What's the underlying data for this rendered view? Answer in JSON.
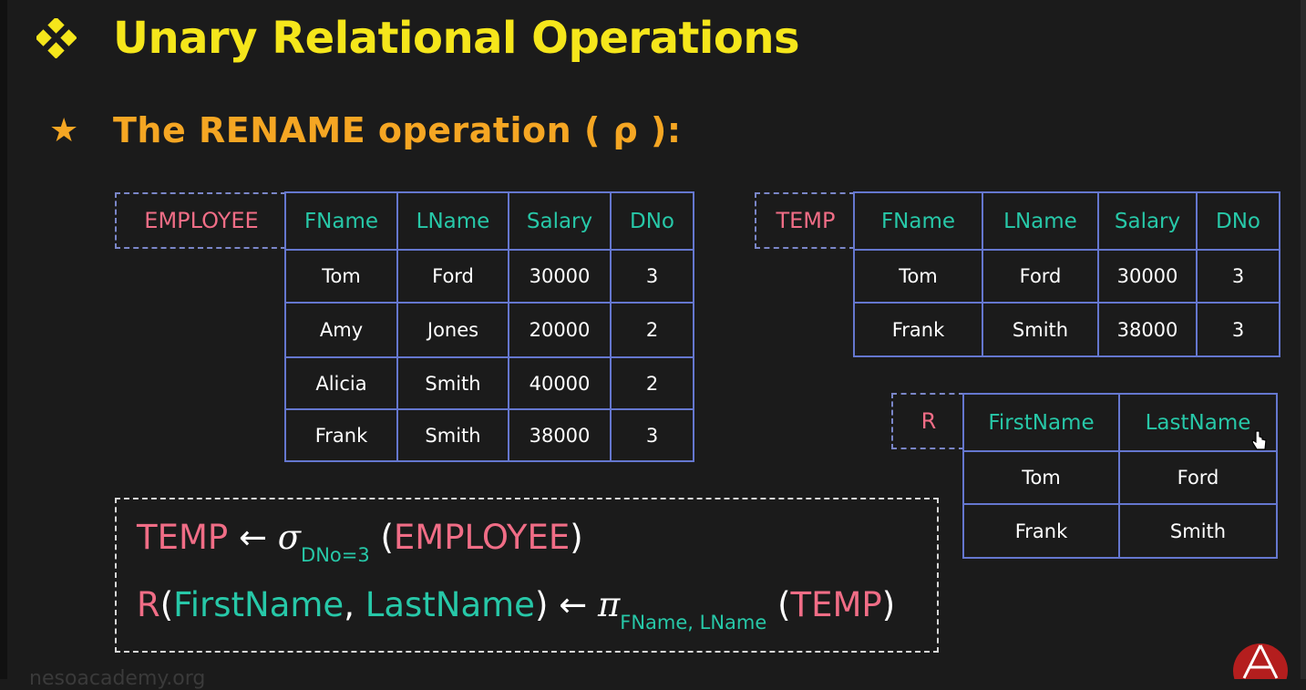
{
  "title": "Unary Relational Operations",
  "subtitle": "The RENAME operation ( ρ ):",
  "icons": {
    "bullet": "diamond-cluster-icon",
    "star": "star-icon",
    "cursor": "hand-cursor-icon",
    "logo": "neso-logo-icon"
  },
  "colors": {
    "title": "#f5e61b",
    "subtitle": "#f5a623",
    "relation_name": "#f06d86",
    "attribute": "#27c8a8",
    "table_border": "#6577cf"
  },
  "employee": {
    "name": "EMPLOYEE",
    "columns": [
      "FName",
      "LName",
      "Salary",
      "DNo"
    ],
    "rows": [
      [
        "Tom",
        "Ford",
        "30000",
        "3"
      ],
      [
        "Amy",
        "Jones",
        "20000",
        "2"
      ],
      [
        "Alicia",
        "Smith",
        "40000",
        "2"
      ],
      [
        "Frank",
        "Smith",
        "38000",
        "3"
      ]
    ]
  },
  "temp": {
    "name": "TEMP",
    "columns": [
      "FName",
      "LName",
      "Salary",
      "DNo"
    ],
    "rows": [
      [
        "Tom",
        "Ford",
        "30000",
        "3"
      ],
      [
        "Frank",
        "Smith",
        "38000",
        "3"
      ]
    ]
  },
  "r": {
    "name": "R",
    "columns": [
      "FirstName",
      "LastName"
    ],
    "rows": [
      [
        "Tom",
        "Ford"
      ],
      [
        "Frank",
        "Smith"
      ]
    ]
  },
  "expr1": {
    "lhs": "TEMP",
    "arrow": "←",
    "op": "σ",
    "cond": "DNo=3",
    "open": "(",
    "arg": "EMPLOYEE",
    "close": ")"
  },
  "expr2": {
    "rel": "R",
    "open": "(",
    "attr1": "FirstName",
    "comma": ",",
    "attr2": "LastName",
    "close": ")",
    "arrow": "←",
    "op": "π",
    "attrs": "FName, LName",
    "open2": "(",
    "arg": "TEMP",
    "close2": ")"
  },
  "watermark": "nesoacademy.org"
}
